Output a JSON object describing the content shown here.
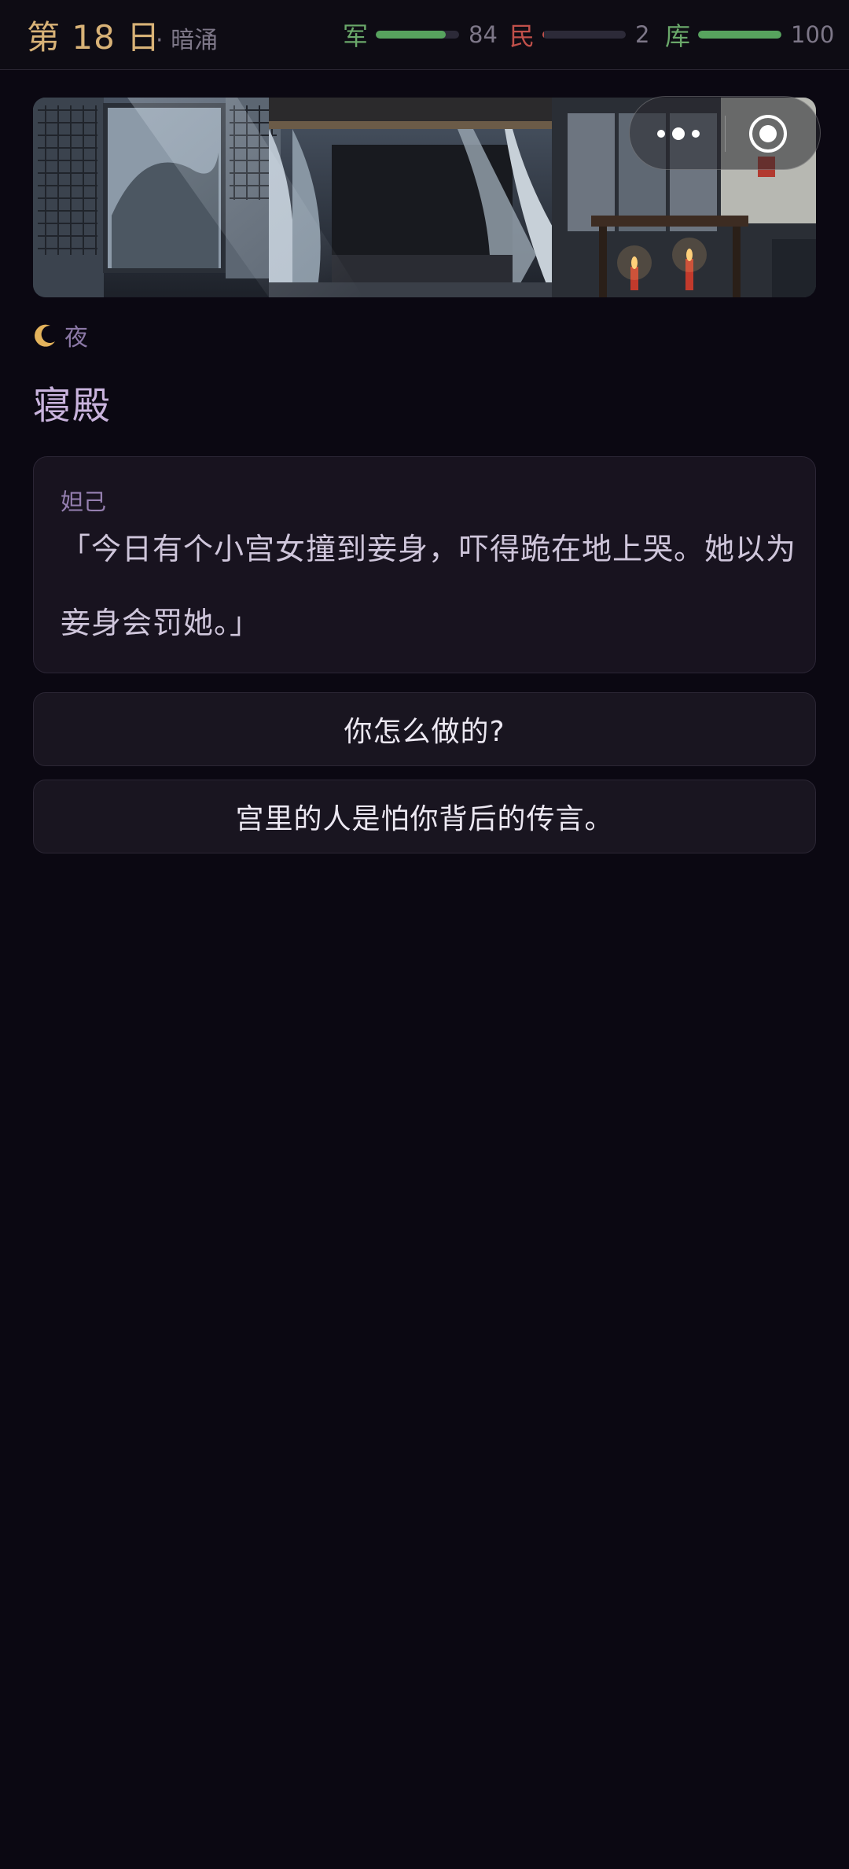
{
  "status": {
    "day_label": "第 18 日",
    "phase_label": "· 暗涌",
    "stats": [
      {
        "label": "军",
        "value_text": "84",
        "fraction": 0.84,
        "color": "#57a35e",
        "label_color": "#6aa86a"
      },
      {
        "label": "民",
        "value_text": "2",
        "fraction": 0.02,
        "color": "#c0504a",
        "label_color": "#c0504a"
      },
      {
        "label": "库",
        "value_text": "100",
        "fraction": 1.0,
        "color": "#57a35e",
        "label_color": "#6aa86a"
      }
    ]
  },
  "scene": {
    "time_label": "夜",
    "time_icon": "crescent-moon-icon",
    "place_title": "寝殿"
  },
  "dialogue": {
    "speaker": "妲己",
    "line": "「今日有个小宫女撞到妾身，吓得跪在地上哭。她以为妾身会罚她。」"
  },
  "choices": [
    {
      "label": "你怎么做的?"
    },
    {
      "label": "宫里的人是怕你背后的传言。"
    }
  ],
  "capsule": {
    "more_icon": "more-dots-icon",
    "close_icon": "close-circle-icon"
  }
}
